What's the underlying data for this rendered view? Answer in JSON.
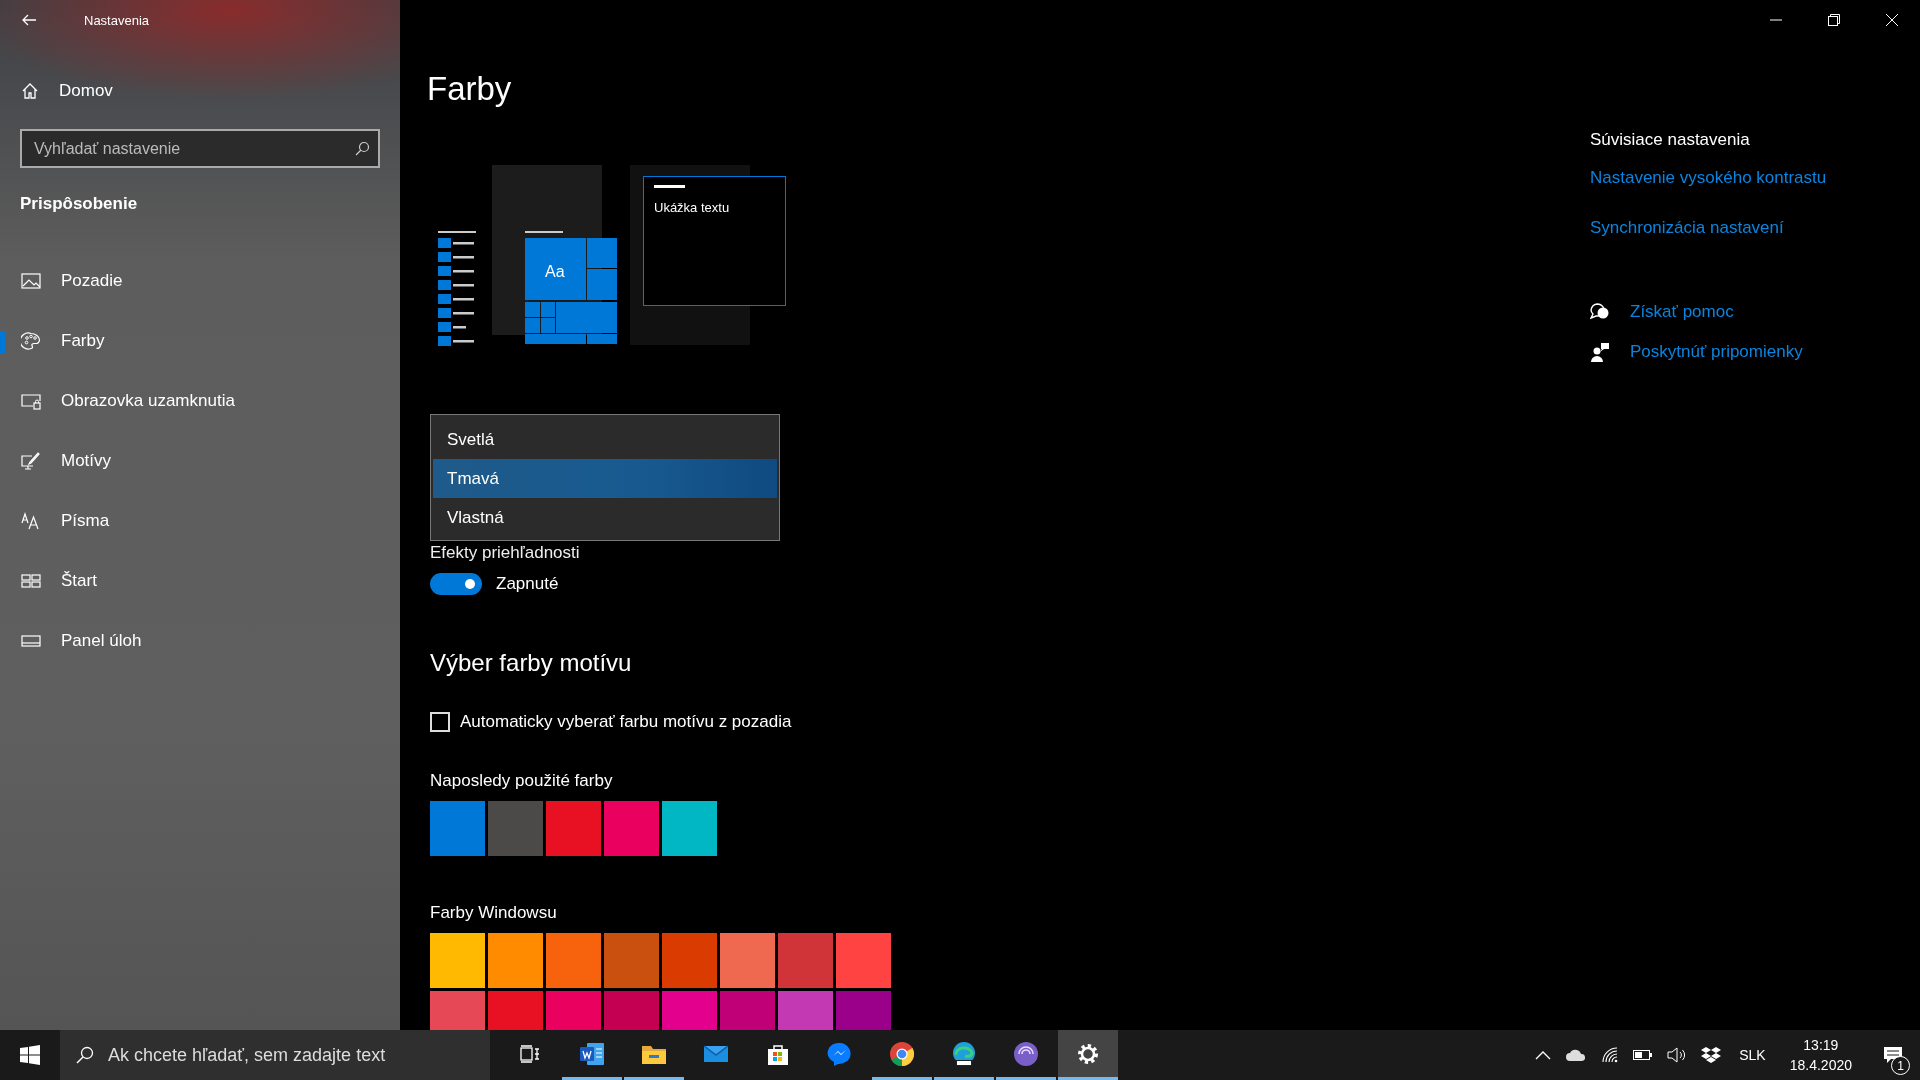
{
  "window": {
    "title": "Nastavenia"
  },
  "sidebar": {
    "home": "Domov",
    "search": {
      "placeholder": "Vyhľadať nastavenie"
    },
    "section": "Prispôsobenie",
    "items": [
      {
        "label": "Pozadie",
        "kind": "picture",
        "selected": false
      },
      {
        "label": "Farby",
        "kind": "palette",
        "selected": true
      },
      {
        "label": "Obrazovka uzamknutia",
        "kind": "lockscreen",
        "selected": false
      },
      {
        "label": "Motívy",
        "kind": "themes",
        "selected": false
      },
      {
        "label": "Písma",
        "kind": "fonts",
        "selected": false
      },
      {
        "label": "Štart",
        "kind": "start",
        "selected": false
      },
      {
        "label": "Panel úloh",
        "kind": "taskbar",
        "selected": false
      }
    ]
  },
  "main": {
    "title": "Farby",
    "preview": {
      "tile_text": "Aa",
      "sample_text": "Ukážka textu"
    },
    "mode_menu": [
      {
        "label": "Svetlá",
        "selected": false
      },
      {
        "label": "Tmavá",
        "selected": true
      },
      {
        "label": "Vlastná",
        "selected": false
      }
    ],
    "transparency": {
      "label": "Efekty priehľadnosti",
      "on": true,
      "state_label": "Zapnuté"
    },
    "accent": {
      "heading": "Výber farby motívu",
      "auto": {
        "label": "Automaticky vyberať farbu motívu z pozadia",
        "checked": false
      },
      "recent": {
        "label": "Naposledy použité farby",
        "swatches": [
          {
            "color": "#0078d7"
          },
          {
            "color": "#4c4a48"
          },
          {
            "color": "#e81123"
          },
          {
            "color": "#ea005e"
          },
          {
            "color": "#00b7c3"
          }
        ]
      },
      "windows": {
        "label": "Farby Windowsu",
        "swatches": [
          {
            "color": "#ffb900"
          },
          {
            "color": "#ff8c00"
          },
          {
            "color": "#f7630c"
          },
          {
            "color": "#ca5010"
          },
          {
            "color": "#da3b01"
          },
          {
            "color": "#ef6950"
          },
          {
            "color": "#d13438"
          },
          {
            "color": "#ff4343"
          },
          {
            "color": "#e74856"
          },
          {
            "color": "#e81123"
          },
          {
            "color": "#ea005e"
          },
          {
            "color": "#c30052"
          },
          {
            "color": "#e3008c"
          },
          {
            "color": "#bf0077"
          },
          {
            "color": "#c239b3"
          },
          {
            "color": "#9a0089"
          }
        ]
      }
    }
  },
  "related": {
    "heading": "Súvisiace nastavenia",
    "links": [
      "Nastavenie vysokého kontrastu",
      "Synchronizácia nastavení"
    ],
    "help": [
      {
        "label": "Získať pomoc",
        "kind": "help"
      },
      {
        "label": "Poskytnúť pripomienky",
        "kind": "feedback"
      }
    ]
  },
  "taskbar": {
    "search": {
      "placeholder": "Ak chcete hľadať, sem zadajte text"
    },
    "apps": [
      {
        "kind": "word",
        "running": true,
        "selected": false
      },
      {
        "kind": "folder",
        "running": true,
        "selected": false
      },
      {
        "kind": "mail",
        "running": false,
        "selected": false
      },
      {
        "kind": "store",
        "running": false,
        "selected": false
      },
      {
        "kind": "messenger",
        "running": false,
        "selected": false
      },
      {
        "kind": "chrome",
        "running": true,
        "selected": false
      },
      {
        "kind": "edge",
        "running": true,
        "selected": false
      },
      {
        "kind": "browser",
        "running": true,
        "selected": false
      },
      {
        "kind": "settings",
        "running": true,
        "selected": true
      }
    ],
    "tray": {
      "language": "SLK",
      "time": "13:19",
      "date": "18.4.2020",
      "notifications": "1"
    }
  }
}
